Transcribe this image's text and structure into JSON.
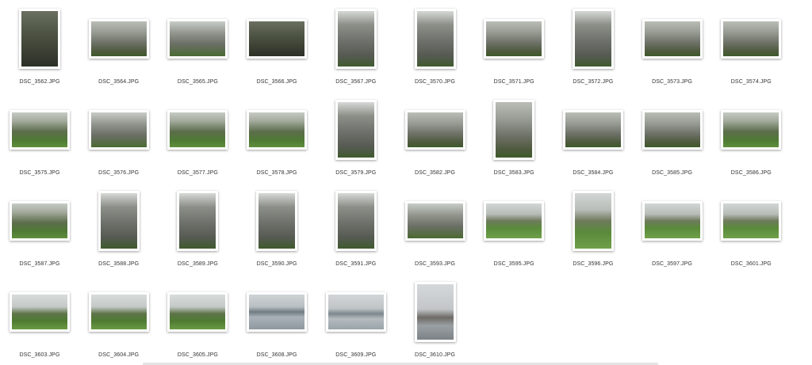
{
  "files": [
    {
      "name": "DSC_3562.JPG",
      "orientation": "portrait",
      "scene": "dark"
    },
    {
      "name": "DSC_3564.JPG",
      "orientation": "landscape",
      "scene": "ruin"
    },
    {
      "name": "DSC_3565.JPG",
      "orientation": "landscape",
      "scene": "ruin2"
    },
    {
      "name": "DSC_3566.JPG",
      "orientation": "landscape",
      "scene": "dark"
    },
    {
      "name": "DSC_3567.JPG",
      "orientation": "portrait",
      "scene": "tall"
    },
    {
      "name": "DSC_3570.JPG",
      "orientation": "portrait",
      "scene": "tall"
    },
    {
      "name": "DSC_3571.JPG",
      "orientation": "landscape",
      "scene": "ruin"
    },
    {
      "name": "DSC_3572.JPG",
      "orientation": "portrait",
      "scene": "tall"
    },
    {
      "name": "DSC_3573.JPG",
      "orientation": "landscape",
      "scene": "ruin"
    },
    {
      "name": "DSC_3574.JPG",
      "orientation": "landscape",
      "scene": "ruin"
    },
    {
      "name": "DSC_3575.JPG",
      "orientation": "landscape",
      "scene": "green"
    },
    {
      "name": "DSC_3576.JPG",
      "orientation": "landscape",
      "scene": "ruin2"
    },
    {
      "name": "DSC_3577.JPG",
      "orientation": "landscape",
      "scene": "green"
    },
    {
      "name": "DSC_3578.JPG",
      "orientation": "landscape",
      "scene": "green"
    },
    {
      "name": "DSC_3579.JPG",
      "orientation": "portrait",
      "scene": "tall"
    },
    {
      "name": "DSC_3582.JPG",
      "orientation": "landscape",
      "scene": "ruin"
    },
    {
      "name": "DSC_3583.JPG",
      "orientation": "portrait",
      "scene": "ruin"
    },
    {
      "name": "DSC_3584.JPG",
      "orientation": "landscape",
      "scene": "ruin"
    },
    {
      "name": "DSC_3585.JPG",
      "orientation": "landscape",
      "scene": "ruin"
    },
    {
      "name": "DSC_3586.JPG",
      "orientation": "landscape",
      "scene": "green"
    },
    {
      "name": "DSC_3587.JPG",
      "orientation": "landscape",
      "scene": "green"
    },
    {
      "name": "DSC_3588.JPG",
      "orientation": "portrait",
      "scene": "tall"
    },
    {
      "name": "DSC_3589.JPG",
      "orientation": "portrait",
      "scene": "tall"
    },
    {
      "name": "DSC_3590.JPG",
      "orientation": "portrait",
      "scene": "tall"
    },
    {
      "name": "DSC_3591.JPG",
      "orientation": "portrait",
      "scene": "tall"
    },
    {
      "name": "DSC_3593.JPG",
      "orientation": "landscape",
      "scene": "ruin2"
    },
    {
      "name": "DSC_3595.JPG",
      "orientation": "landscape",
      "scene": "field"
    },
    {
      "name": "DSC_3596.JPG",
      "orientation": "portrait",
      "scene": "field"
    },
    {
      "name": "DSC_3597.JPG",
      "orientation": "landscape",
      "scene": "field"
    },
    {
      "name": "DSC_3601.JPG",
      "orientation": "landscape",
      "scene": "field"
    },
    {
      "name": "DSC_3603.JPG",
      "orientation": "landscape",
      "scene": "hill"
    },
    {
      "name": "DSC_3604.JPG",
      "orientation": "landscape",
      "scene": "hill"
    },
    {
      "name": "DSC_3605.JPG",
      "orientation": "landscape",
      "scene": "hill"
    },
    {
      "name": "DSC_3608.JPG",
      "orientation": "landscape",
      "scene": "sea"
    },
    {
      "name": "DSC_3609.JPG",
      "orientation": "landscape",
      "scene": "pier"
    },
    {
      "name": "DSC_3610.JPG",
      "orientation": "portrait",
      "scene": "tower"
    }
  ]
}
